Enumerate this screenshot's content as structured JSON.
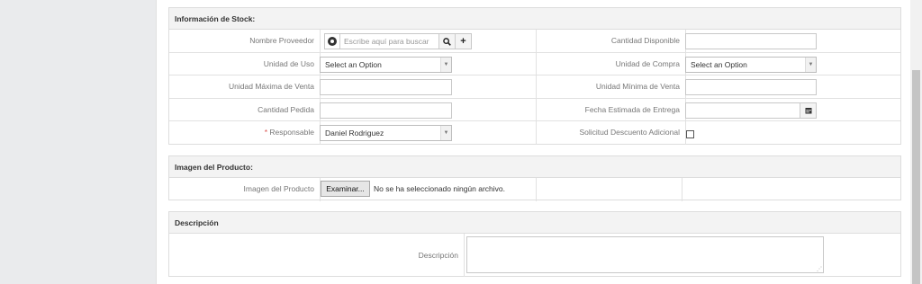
{
  "stock": {
    "title": "Información de Stock:",
    "supplier_label": "Nombre Proveedor",
    "supplier_placeholder": "Escribe aquí para buscar",
    "available_qty_label": "Cantidad Disponible",
    "unit_use_label": "Unidad de Uso",
    "unit_use_value": "Select an Option",
    "unit_purchase_label": "Unidad de Compra",
    "unit_purchase_value": "Select an Option",
    "max_sale_label": "Unidad Máxima de Venta",
    "min_sale_label": "Unidad Mínima de Venta",
    "ordered_qty_label": "Cantidad Pedida",
    "delivery_date_label": "Fecha Estimada de Entrega",
    "responsible_required_mark": "*",
    "responsible_label": "Responsable",
    "responsible_value": "Daniel Rodriguez",
    "discount_label": "Solicitud Descuento Adicional"
  },
  "image": {
    "title": "Imagen del Producto:",
    "label": "Imagen del Producto",
    "browse_button": "Examinar...",
    "no_file_text": "No se ha seleccionado ningún archivo."
  },
  "description": {
    "title": "Descripción",
    "label": "Descripción"
  }
}
